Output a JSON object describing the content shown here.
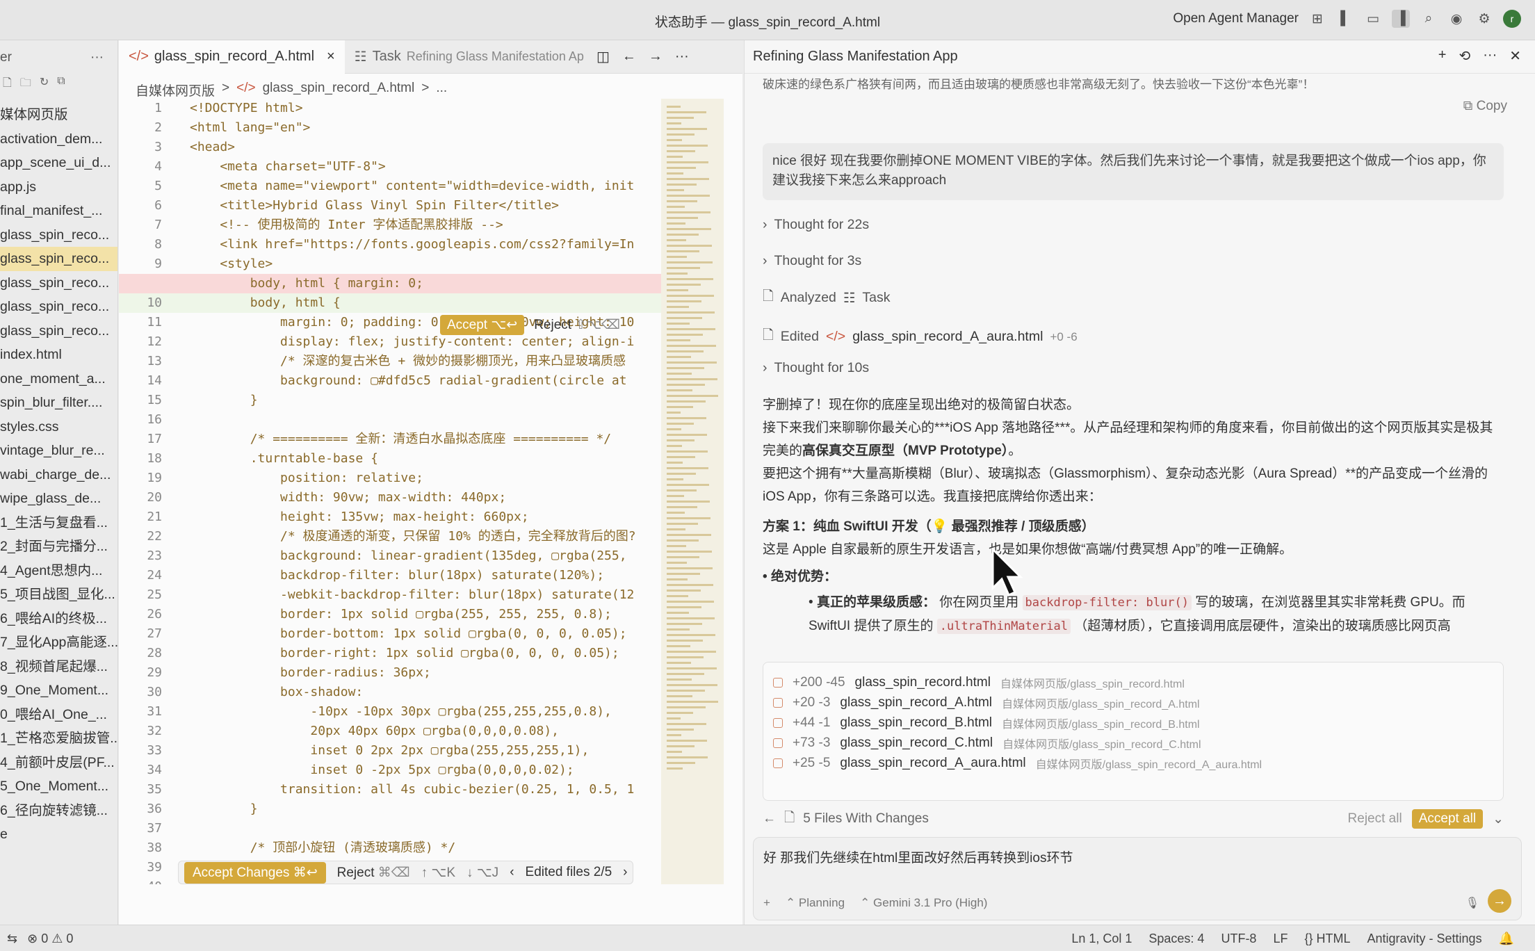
{
  "window": {
    "title": "状态助手 — glass_spin_record_A.html",
    "agent_manager": "Open Agent Manager"
  },
  "explorer": {
    "header": "er",
    "files": [
      "媒体网页版",
      "activation_dem...",
      "app_scene_ui_d...",
      "app.js",
      "final_manifest_...",
      "glass_spin_reco...",
      "glass_spin_reco...",
      "glass_spin_reco...",
      "glass_spin_reco...",
      "glass_spin_reco...",
      "index.html",
      "one_moment_a...",
      "spin_blur_filter....",
      "styles.css",
      "vintage_blur_re...",
      "wabi_charge_de...",
      "wipe_glass_de...",
      "1_生活与复盘看...",
      "2_封面与完播分...",
      "4_Agent思想内...",
      "5_项目战图_显化...",
      "6_喂给AI的终极...",
      "7_显化App高能逐...",
      "8_视频首尾起爆...",
      "9_One_Moment...",
      "0_喂给AI_One_...",
      "1_芒格恋爱脑拔管...",
      "4_前额叶皮层(PF...",
      "5_One_Moment...",
      "6_径向旋转滤镜..."
    ],
    "selected_index": 6,
    "footer": "e"
  },
  "editor": {
    "tabs": [
      {
        "label": "glass_spin_record_A.html",
        "close": "×"
      },
      {
        "prefix": "Task",
        "label": "Refining Glass Manifestation Ap"
      }
    ],
    "breadcrumb": [
      "自媒体网页版",
      ">",
      "glass_spin_record_A.html",
      ">",
      "..."
    ],
    "lines": [
      {
        "n": "1",
        "t": "<!DOCTYPE html>",
        "k": ""
      },
      {
        "n": "2",
        "t": "<html lang=\"en\">",
        "k": ""
      },
      {
        "n": "3",
        "t": "<head>",
        "k": ""
      },
      {
        "n": "4",
        "t": "    <meta charset=\"UTF-8\">",
        "k": ""
      },
      {
        "n": "5",
        "t": "    <meta name=\"viewport\" content=\"width=device-width, init",
        "k": ""
      },
      {
        "n": "6",
        "t": "    <title>Hybrid Glass Vinyl Spin Filter</title>",
        "k": ""
      },
      {
        "n": "7",
        "t": "    <!-- 使用极简的 Inter 字体适配黑胶排版 -->",
        "k": ""
      },
      {
        "n": "8",
        "t": "    <link href=\"https://fonts.googleapis.com/css2?family=In",
        "k": ""
      },
      {
        "n": "9",
        "t": "    <style>",
        "k": ""
      },
      {
        "n": "",
        "t": "        body, html { margin: 0;",
        "k": "del"
      },
      {
        "n": "10",
        "t": "        body, html {",
        "k": "add"
      },
      {
        "n": "11",
        "t": "            margin: 0; padding: 0; width: 100vw; height: 10",
        "k": ""
      },
      {
        "n": "12",
        "t": "            display: flex; justify-content: center; align-i",
        "k": ""
      },
      {
        "n": "13",
        "t": "            /* 深邃的复古米色 + 微妙的摄影棚顶光，用来凸显玻璃质感",
        "k": ""
      },
      {
        "n": "14",
        "t": "            background: ▢#dfd5c5 radial-gradient(circle at",
        "k": ""
      },
      {
        "n": "15",
        "t": "        }",
        "k": ""
      },
      {
        "n": "16",
        "t": "",
        "k": ""
      },
      {
        "n": "17",
        "t": "        /* ========== 全新：清透白水晶拟态底座 ========== */",
        "k": ""
      },
      {
        "n": "18",
        "t": "        .turntable-base {",
        "k": ""
      },
      {
        "n": "19",
        "t": "            position: relative;",
        "k": ""
      },
      {
        "n": "20",
        "t": "            width: 90vw; max-width: 440px;",
        "k": ""
      },
      {
        "n": "21",
        "t": "            height: 135vw; max-height: 660px;",
        "k": ""
      },
      {
        "n": "22",
        "t": "            /* 极度通透的渐变，只保留 10% 的透白，完全释放背后的图?",
        "k": ""
      },
      {
        "n": "23",
        "t": "            background: linear-gradient(135deg, ▢rgba(255,",
        "k": ""
      },
      {
        "n": "24",
        "t": "            backdrop-filter: blur(18px) saturate(120%);",
        "k": ""
      },
      {
        "n": "25",
        "t": "            -webkit-backdrop-filter: blur(18px) saturate(12",
        "k": ""
      },
      {
        "n": "26",
        "t": "            border: 1px solid ▢rgba(255, 255, 255, 0.8);",
        "k": ""
      },
      {
        "n": "27",
        "t": "            border-bottom: 1px solid ▢rgba(0, 0, 0, 0.05);",
        "k": ""
      },
      {
        "n": "28",
        "t": "            border-right: 1px solid ▢rgba(0, 0, 0, 0.05);",
        "k": ""
      },
      {
        "n": "29",
        "t": "            border-radius: 36px;",
        "k": ""
      },
      {
        "n": "30",
        "t": "            box-shadow:",
        "k": ""
      },
      {
        "n": "31",
        "t": "                -10px -10px 30px ▢rgba(255,255,255,0.8),",
        "k": ""
      },
      {
        "n": "32",
        "t": "                20px 40px 60px ▢rgba(0,0,0,0.08),",
        "k": ""
      },
      {
        "n": "33",
        "t": "                inset 0 2px 2px ▢rgba(255,255,255,1),",
        "k": ""
      },
      {
        "n": "34",
        "t": "                inset 0 -2px 5px ▢rgba(0,0,0,0.02);",
        "k": ""
      },
      {
        "n": "35",
        "t": "            transition: all 4s cubic-bezier(0.25, 1, 0.5, 1",
        "k": ""
      },
      {
        "n": "36",
        "t": "        }",
        "k": ""
      },
      {
        "n": "37",
        "t": "",
        "k": ""
      },
      {
        "n": "38",
        "t": "        /* 顶部小旋钮 (清透玻璃质感) */",
        "k": ""
      },
      {
        "n": "39",
        "t": "        .base-knob-small {",
        "k": ""
      },
      {
        "n": "40",
        "t": "",
        "k": ""
      },
      {
        "n": "41",
        "t": "",
        "k": ""
      }
    ],
    "inline": {
      "accept": "Accept",
      "accept_key": "⌥↩",
      "reject": "Reject",
      "reject_key": "⇧⌥⌫"
    },
    "bottom": {
      "accept": "Accept Changes",
      "accept_key": "⌘↩",
      "reject": "Reject",
      "reject_key": "⌘⌫",
      "nav1": "↑ ⌥K",
      "nav2": "↓ ⌥J",
      "edited": "Edited files 2/5"
    }
  },
  "panel": {
    "title": "Refining Glass Manifestation App",
    "copy": "Copy",
    "truncated_top": "破床速的绿色系广格狭有间两，而且适由玻璃的梗质感也非常高级无刻了。快去验收一下这份“本色光辜”！",
    "user_msg": "nice 很好 现在我要你删掉ONE MOMENT VIBE的字体。然后我们先来讨论一个事情，就是我要把这个做成一个ios app，你建议我接下来怎么来approach",
    "thought1": "Thought for 22s",
    "thought2": "Thought for 3s",
    "analyzed": "Analyzed",
    "analyzed_task": "Task",
    "edited": "Edited",
    "edited_file": "glass_spin_record_A_aura.html",
    "edited_stats": "+0 -6",
    "thought3": "Thought for 10s",
    "p1": "字删掉了！现在你的底座呈现出绝对的极简留白状态。",
    "p2": "接下来我们来聊聊你最关心的***iOS App 落地路径***。从产品经理和架构师的角度来看，你目前做出的这个网页版其实是极其完美的",
    "p2b": "高保真交互原型（MVP Prototype）",
    "p2c": "。",
    "p3": "要把这个拥有**大量高斯模糊（Blur）、玻璃拟态（Glassmorphism）、复杂动态光影（Aura Spread）**的产品变成一个丝滑的 iOS App，你有三条路可以选。我直接把底牌给你透出来：",
    "h1": "方案 1：纯血 SwiftUI 开发（",
    "h1b": "💡 最强烈推荐 / 顶级质感）",
    "p4": "这是 Apple 自家最新的原生开发语言，也是如果你想做“高端/付费冥想 App”的唯一正确解。",
    "b1": "绝对优势：",
    "b2a": "真正的苹果级质感：",
    "b2b": "你在网页里用",
    "b2code": "backdrop-filter: blur()",
    "b2c": "写的玻璃，在浏览器里其实非常耗费 GPU。而 SwiftUI 提供了原生的",
    "b2code2": ".ultraThinMaterial",
    "b2d": "（超薄材质），它直接调用底层硬件，渲染出的玻璃质感比网页高",
    "changes": [
      {
        "stat": "+200 -45",
        "name": "glass_spin_record.html",
        "path": "自媒体网页版/glass_spin_record.html"
      },
      {
        "stat": "+20 -3",
        "name": "glass_spin_record_A.html",
        "path": "自媒体网页版/glass_spin_record_A.html"
      },
      {
        "stat": "+44 -1",
        "name": "glass_spin_record_B.html",
        "path": "自媒体网页版/glass_spin_record_B.html"
      },
      {
        "stat": "+73 -3",
        "name": "glass_spin_record_C.html",
        "path": "自媒体网页版/glass_spin_record_C.html"
      },
      {
        "stat": "+25 -5",
        "name": "glass_spin_record_A_aura.html",
        "path": "自媒体网页版/glass_spin_record_A_aura.html"
      }
    ],
    "files_changed": "5 Files With Changes",
    "reject_all": "Reject all",
    "accept_all": "Accept all",
    "input_text": "好 那我们先继续在html里面改好然后再转换到ios环节",
    "plus": "+",
    "mode": "Planning",
    "model": "Gemini 3.1 Pro (High)"
  },
  "status": {
    "errors": "0",
    "warnings": "0",
    "ln": "Ln 1, Col 1",
    "spaces": "Spaces: 4",
    "enc": "UTF-8",
    "eol": "LF",
    "lang": "HTML",
    "settings": "Antigravity - Settings"
  }
}
